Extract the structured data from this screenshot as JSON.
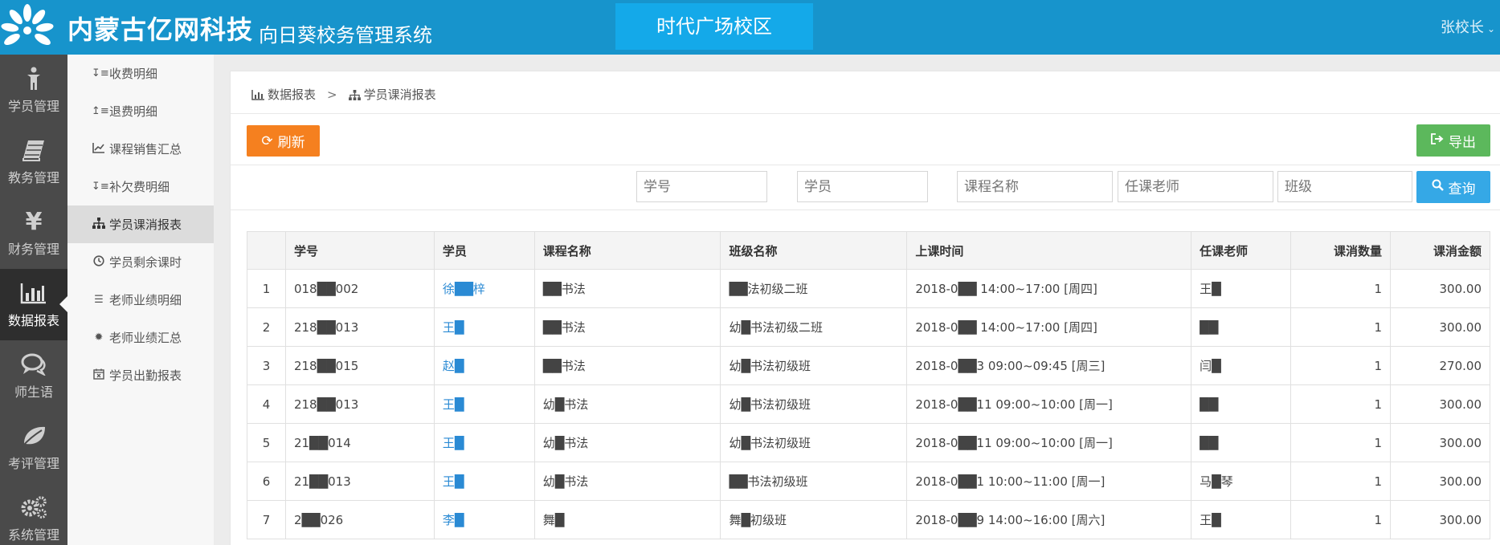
{
  "header": {
    "brand": "内蒙古亿网科技",
    "system_name": "向日葵校务管理系统",
    "campus": "时代广场校区",
    "user": "张校长",
    "colors": {
      "header_bg": "#1794cc",
      "campus_bg": "#14a9e9"
    }
  },
  "icon_nav": [
    {
      "label": "学员管理",
      "icon": "person-icon"
    },
    {
      "label": "教务管理",
      "icon": "book-icon"
    },
    {
      "label": "财务管理",
      "icon": "yen-icon"
    },
    {
      "label": "数据报表",
      "icon": "bar-chart-icon",
      "active": true
    },
    {
      "label": "师生语",
      "icon": "chat-icon"
    },
    {
      "label": "考评管理",
      "icon": "leaf-icon"
    },
    {
      "label": "系统管理",
      "icon": "gears-icon"
    }
  ],
  "sub_nav": [
    {
      "label": "收费明细",
      "icon": "sort-amount-down-icon"
    },
    {
      "label": "退费明细",
      "icon": "sort-amount-up-icon"
    },
    {
      "label": "课程销售汇总",
      "icon": "line-chart-icon"
    },
    {
      "label": "补欠费明细",
      "icon": "sort-amount-down-icon"
    },
    {
      "label": "学员课消报表",
      "icon": "sitemap-icon",
      "active": true
    },
    {
      "label": "学员剩余课时",
      "icon": "clock-icon"
    },
    {
      "label": "老师业绩明细",
      "icon": "list-icon"
    },
    {
      "label": "老师业绩汇总",
      "icon": "gear-icon"
    },
    {
      "label": "学员出勤报表",
      "icon": "calendar-x-icon"
    }
  ],
  "breadcrumb": {
    "root": "数据报表",
    "separator": ">",
    "current": "学员课消报表"
  },
  "toolbar": {
    "refresh_label": "刷新",
    "export_label": "导出",
    "search_label": "查询"
  },
  "filters": {
    "student_id": "学号",
    "student": "学员",
    "course": "课程名称",
    "teacher": "任课老师",
    "class": "班级"
  },
  "table": {
    "columns": [
      "",
      "学号",
      "学员",
      "课程名称",
      "班级名称",
      "上课时间",
      "任课老师",
      "课消数量",
      "课消金额"
    ],
    "rows": [
      {
        "no": "1",
        "student_id": "018██002",
        "student": "徐██梓",
        "course": "██书法",
        "class": "██法初级二班",
        "time": "2018-0██ 14:00~17:00 [周四]",
        "teacher": "王█",
        "qty": "1",
        "amount": "300.00"
      },
      {
        "no": "2",
        "student_id": "218██013",
        "student": "王█",
        "course": "██书法",
        "class": "幼█书法初级二班",
        "time": "2018-0██ 14:00~17:00 [周四]",
        "teacher": "██",
        "qty": "1",
        "amount": "300.00"
      },
      {
        "no": "3",
        "student_id": "218██015",
        "student": "赵█",
        "course": "██书法",
        "class": "幼█书法初级班",
        "time": "2018-0██3 09:00~09:45 [周三]",
        "teacher": "闫█",
        "qty": "1",
        "amount": "270.00"
      },
      {
        "no": "4",
        "student_id": "218██013",
        "student": "王█",
        "course": "幼█书法",
        "class": "幼█书法初级班",
        "time": "2018-0██11 09:00~10:00 [周一]",
        "teacher": "██",
        "qty": "1",
        "amount": "300.00"
      },
      {
        "no": "5",
        "student_id": "21██014",
        "student": "王█",
        "course": "幼█书法",
        "class": "幼█书法初级班",
        "time": "2018-0██11 09:00~10:00 [周一]",
        "teacher": "██",
        "qty": "1",
        "amount": "300.00"
      },
      {
        "no": "6",
        "student_id": "21██013",
        "student": "王█",
        "course": "幼█书法",
        "class": "██书法初级班",
        "time": "2018-0██1 10:00~11:00 [周一]",
        "teacher": "马█琴",
        "qty": "1",
        "amount": "300.00"
      },
      {
        "no": "7",
        "student_id": "2██026",
        "student": "李█",
        "course": "舞█",
        "class": "舞█初级班",
        "time": "2018-0██9 14:00~16:00 [周六]",
        "teacher": "王█",
        "qty": "1",
        "amount": "300.00"
      }
    ]
  }
}
